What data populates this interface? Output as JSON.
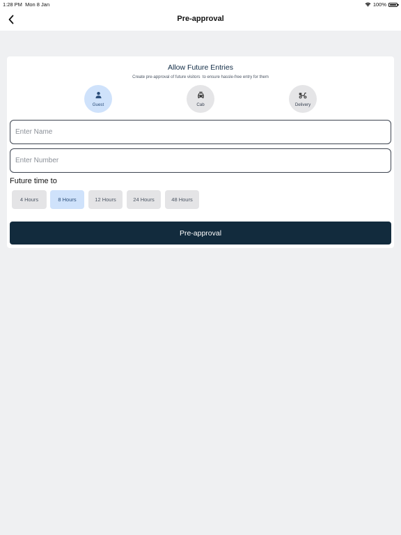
{
  "status_bar": {
    "time": "1:28 PM",
    "date": "Mon 8 Jan",
    "battery": "100%"
  },
  "nav": {
    "title": "Pre-approval"
  },
  "card": {
    "title": "Allow Future Entries",
    "subtitle": "Create pre-approval of future visitors  to ensure hassle-free entry for them",
    "types": [
      {
        "label": "Guest",
        "icon": "person-icon",
        "selected": true
      },
      {
        "label": "Cab",
        "icon": "car-icon",
        "selected": false
      },
      {
        "label": "Delivery",
        "icon": "scooter-icon",
        "selected": false
      }
    ],
    "name_field": {
      "placeholder": "Enter Name",
      "value": ""
    },
    "number_field": {
      "placeholder": "Enter Number",
      "value": ""
    },
    "future_label": "Future time to",
    "hours": [
      {
        "label": "4 Hours",
        "selected": false
      },
      {
        "label": "8 Hours",
        "selected": true
      },
      {
        "label": "12 Hours",
        "selected": false
      },
      {
        "label": "24 Hours",
        "selected": false
      },
      {
        "label": "48 Hours",
        "selected": false
      }
    ],
    "submit_label": "Pre-approval"
  },
  "colors": {
    "accent_dark": "#122b3d",
    "selected_bg": "#cfe2fb",
    "chip_bg": "#e4e4e6",
    "page_bg": "#eff0f2"
  }
}
